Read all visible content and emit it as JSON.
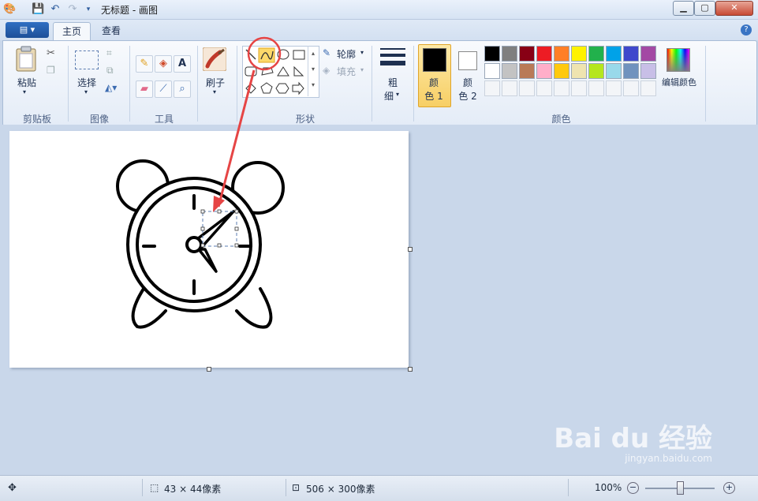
{
  "window": {
    "title": "无标题 - 画图"
  },
  "tabs": [
    {
      "label": "主页"
    },
    {
      "label": "查看"
    }
  ],
  "clipboard": {
    "paste_label": "粘贴",
    "group": "剪贴板"
  },
  "image": {
    "select_label": "选择",
    "group": "图像"
  },
  "tools": {
    "group": "工具",
    "text_glyph": "A"
  },
  "brushes": {
    "label": "刷子"
  },
  "shapes": {
    "group": "形状",
    "outline_label": "轮廓",
    "fill_label": "填充"
  },
  "size": {
    "label_1": "粗",
    "label_2": "细"
  },
  "color1": {
    "label_1": "颜",
    "label_2": "色 1",
    "color": "#000000"
  },
  "color2": {
    "label_1": "颜",
    "label_2": "色 2",
    "color": "#ffffff"
  },
  "colors": {
    "group": "颜色",
    "edit_label": "编辑颜色",
    "row1": [
      "#000000",
      "#7f7f7f",
      "#880015",
      "#ed1c24",
      "#ff7f27",
      "#fff200",
      "#22b14c",
      "#00a2e8",
      "#3f48cc",
      "#a349a4"
    ],
    "row2": [
      "#ffffff",
      "#c3c3c3",
      "#b97a57",
      "#ffaec9",
      "#ffc90e",
      "#efe4b0",
      "#b5e61d",
      "#99d9ea",
      "#7092be",
      "#c8bfe7"
    ]
  },
  "status": {
    "selection_size": "43 × 44像素",
    "canvas_size": "506 × 300像素",
    "zoom": "100%"
  },
  "watermark": {
    "brand": "Bai du 经验",
    "url": "jingyan.baidu.com"
  }
}
